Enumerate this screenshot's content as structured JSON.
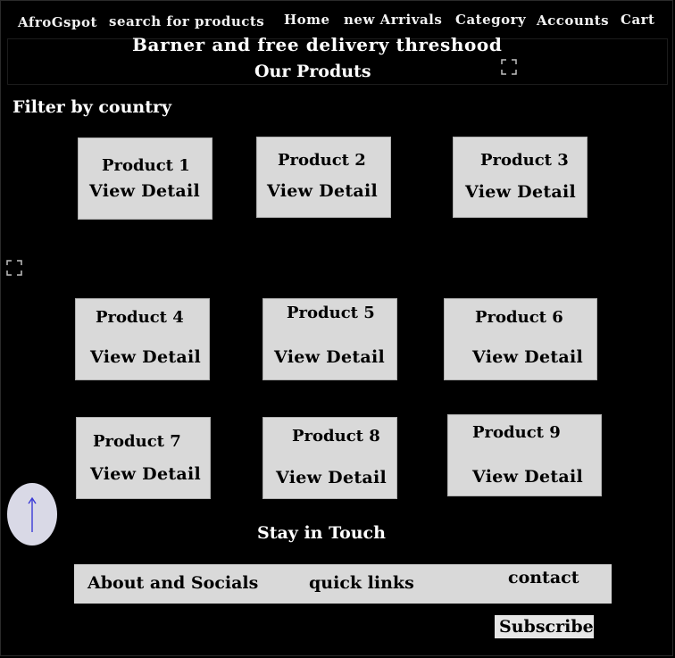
{
  "nav": {
    "brand": "AfroGspot",
    "search_placeholder": "search for products",
    "links": [
      "Home",
      "new Arrivals",
      "Category",
      "Accounts",
      "Cart"
    ]
  },
  "banner": {
    "text": "Barner and free delivery threshood",
    "section_title": "Our Produts"
  },
  "filter_label": "Filter by country",
  "products": [
    {
      "title": "Product 1",
      "action": "View Detail"
    },
    {
      "title": "Product 2",
      "action": "View Detail"
    },
    {
      "title": "Product 3",
      "action": "View Detail"
    },
    {
      "title": "Product 4",
      "action": "View Detail"
    },
    {
      "title": "Product 5",
      "action": "View Detail"
    },
    {
      "title": "Product 6",
      "action": "View Detail"
    },
    {
      "title": "Product 7",
      "action": "View Detail"
    },
    {
      "title": "Product 8",
      "action": "View Detail"
    },
    {
      "title": "Product 9",
      "action": "View Detail"
    }
  ],
  "stay_in_touch": "Stay in Touch",
  "footer": {
    "about": "About and Socials",
    "quick_links": "quick links",
    "contact": "contact"
  },
  "subscribe_label": "Subscribe",
  "icons": {
    "expand": "expand-icon",
    "scroll_up": "arrow-up-icon"
  },
  "colors": {
    "background": "#000000",
    "card": "#d9d9d9",
    "up_button": "#d9d9e6",
    "arrow": "#3b3bd6"
  }
}
